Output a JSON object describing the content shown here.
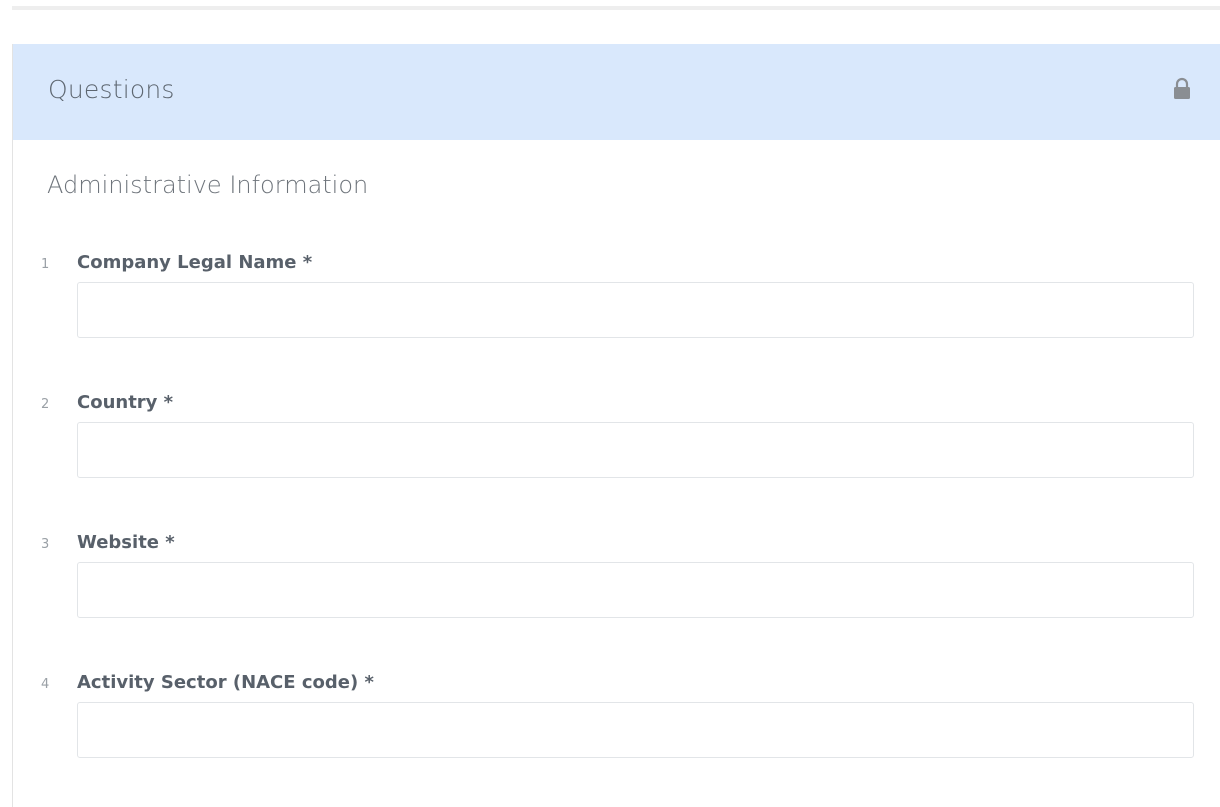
{
  "panel": {
    "title": "Questions",
    "lock_icon": "lock-icon",
    "section_title": "Administrative Information"
  },
  "questions": [
    {
      "number": "1",
      "label": "Company Legal Name *",
      "value": "",
      "placeholder": ""
    },
    {
      "number": "2",
      "label": "Country *",
      "value": "",
      "placeholder": ""
    },
    {
      "number": "3",
      "label": "Website *",
      "value": "",
      "placeholder": ""
    },
    {
      "number": "4",
      "label": "Activity Sector (NACE code) *",
      "value": "",
      "placeholder": ""
    }
  ],
  "colors": {
    "header_background": "#d9e8fc",
    "text": "#58606a",
    "input_border": "#e2e5e8"
  }
}
